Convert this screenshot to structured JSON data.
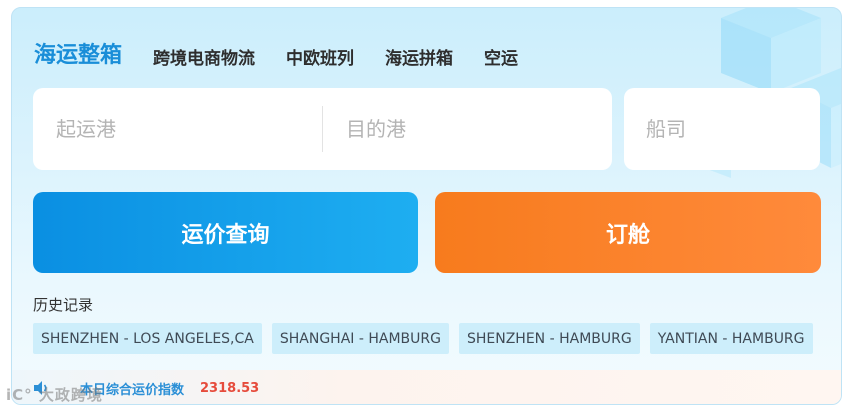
{
  "tabs": [
    "海运整箱",
    "跨境电商物流",
    "中欧班列",
    "海运拼箱",
    "空运"
  ],
  "search": {
    "origin_placeholder": "起运港",
    "destination_placeholder": "目的港",
    "carrier_placeholder": "船司"
  },
  "buttons": {
    "query_label": "运价查询",
    "book_label": "订舱"
  },
  "history": {
    "label": "历史记录",
    "items": [
      "SHENZHEN - LOS ANGELES,CA",
      "SHANGHAI - HAMBURG",
      "SHENZHEN - HAMBURG",
      "YANTIAN - HAMBURG"
    ]
  },
  "index_bar": {
    "label": "本日综合运价指数",
    "value": "2318.53"
  },
  "watermark": "iC° 大政跨境",
  "colors": {
    "accent_blue": "#1a8ed8",
    "query_button": "#0a8fe2",
    "book_button": "#f77b1d",
    "index_value": "#e64b3c"
  }
}
